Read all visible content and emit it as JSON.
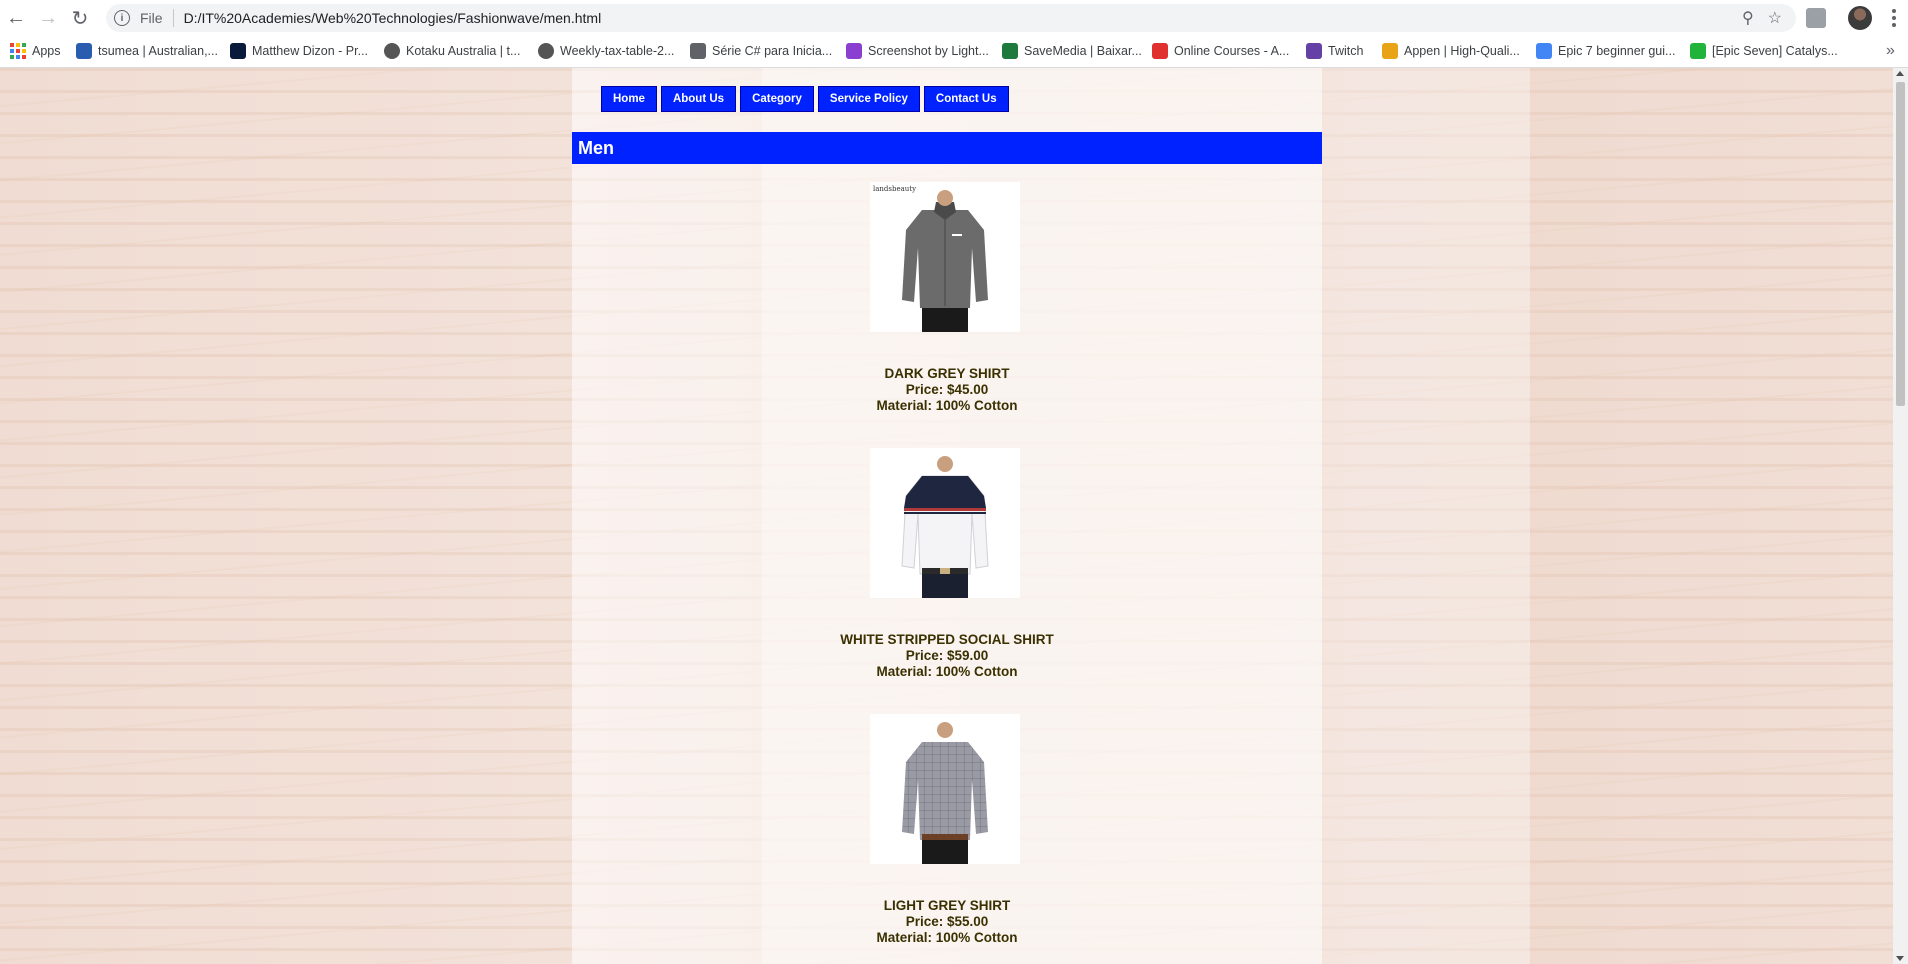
{
  "browser": {
    "scheme": "File",
    "url": "D:/IT%20Academies/Web%20Technologies/Fashionwave/men.html",
    "bookmarks": [
      {
        "label": "Apps",
        "icon": "apps-grid-icon",
        "color": "#ea4335"
      },
      {
        "label": "tsumea | Australian,...",
        "icon": "tsumea-icon",
        "color": "#2a5db0"
      },
      {
        "label": "Matthew Dizon - Pr...",
        "icon": "behance-icon",
        "color": "#0a1a3a"
      },
      {
        "label": "Kotaku Australia | t...",
        "icon": "kotaku-icon",
        "color": "#555555"
      },
      {
        "label": "Weekly-tax-table-2...",
        "icon": "globe-icon",
        "color": "#555555"
      },
      {
        "label": "Série C# para Inicia...",
        "icon": "link-icon",
        "color": "#5f6368"
      },
      {
        "label": "Screenshot by Light...",
        "icon": "lightshot-icon",
        "color": "#8b3fd1"
      },
      {
        "label": "SaveMedia | Baixar...",
        "icon": "savemedia-icon",
        "color": "#1e7a3c"
      },
      {
        "label": "Online Courses - A...",
        "icon": "udemy-icon",
        "color": "#e0312f"
      },
      {
        "label": "Twitch",
        "icon": "twitch-icon",
        "color": "#6441a5"
      },
      {
        "label": "Appen | High-Quali...",
        "icon": "appen-icon",
        "color": "#e8a317"
      },
      {
        "label": "Epic 7 beginner gui...",
        "icon": "docs-icon",
        "color": "#4285f4"
      },
      {
        "label": "[Epic Seven] Catalys...",
        "icon": "line-icon",
        "color": "#21b33a"
      }
    ]
  },
  "page": {
    "nav": [
      {
        "label": "Home"
      },
      {
        "label": "About Us"
      },
      {
        "label": "Category"
      },
      {
        "label": "Service Policy"
      },
      {
        "label": "Contact Us"
      }
    ],
    "heading": "Men",
    "products": [
      {
        "name": "DARK GREY SHIRT",
        "price": "Price: $45.00",
        "material": "Material: 100% Cotton",
        "shirt_color": "#6b6b6b",
        "watermark": "landsbeauty"
      },
      {
        "name": "WHITE STRIPPED SOCIAL SHIRT",
        "price": "Price: $59.00",
        "material": "Material: 100% Cotton",
        "shirt_color": "#f4f4f6",
        "watermark": ""
      },
      {
        "name": "LIGHT GREY SHIRT",
        "price": "Price: $55.00",
        "material": "Material: 100% Cotton",
        "shirt_color": "#9a9aa4",
        "watermark": ""
      }
    ]
  },
  "colors": {
    "nav_bg": "#0022ff",
    "header_bg": "#0022ff",
    "product_text": "#3a3000"
  }
}
